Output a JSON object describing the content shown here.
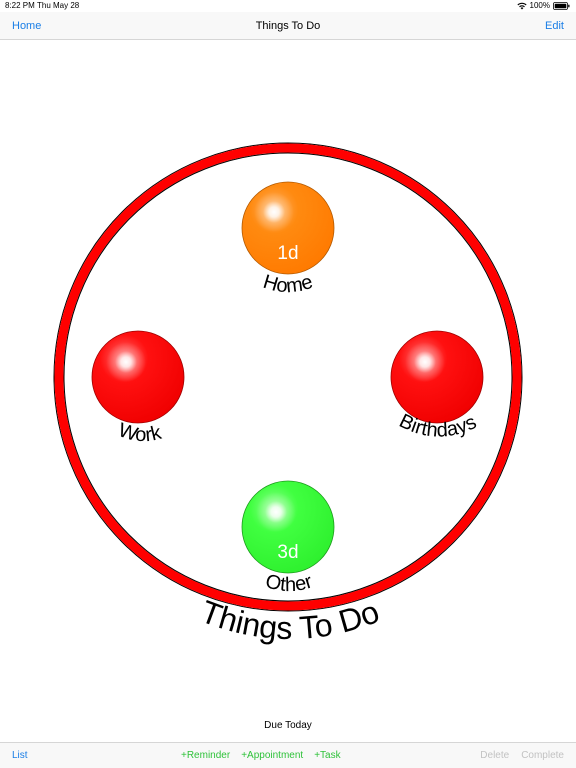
{
  "status_bar": {
    "time": "8:22 PM",
    "date": "Thu May 28",
    "battery": "100%",
    "icons": [
      "wifi-icon",
      "battery-icon"
    ]
  },
  "nav": {
    "left": "Home",
    "title": "Things To Do",
    "right": "Edit"
  },
  "diagram": {
    "ring_label": "Things To Do",
    "ring_color": "#ff0000",
    "bubbles": [
      {
        "id": "home",
        "label": "Home",
        "badge": "1d",
        "color": "#ff8000"
      },
      {
        "id": "work",
        "label": "Work",
        "badge": "",
        "color": "#ff0000"
      },
      {
        "id": "birthdays",
        "label": "Birthdays",
        "badge": "",
        "color": "#ff0000"
      },
      {
        "id": "other",
        "label": "Other",
        "badge": "3d",
        "color": "#33ff33"
      }
    ]
  },
  "footer": {
    "due_today": "Due Today"
  },
  "toolbar": {
    "list": "List",
    "reminder": "+Reminder",
    "appointment": "+Appointment",
    "task": "+Task",
    "delete": "Delete",
    "complete": "Complete"
  },
  "colors": {
    "accent_blue": "#1a7ee6",
    "add_green": "#2fc23a",
    "disabled_gray": "#c2c2c2"
  }
}
